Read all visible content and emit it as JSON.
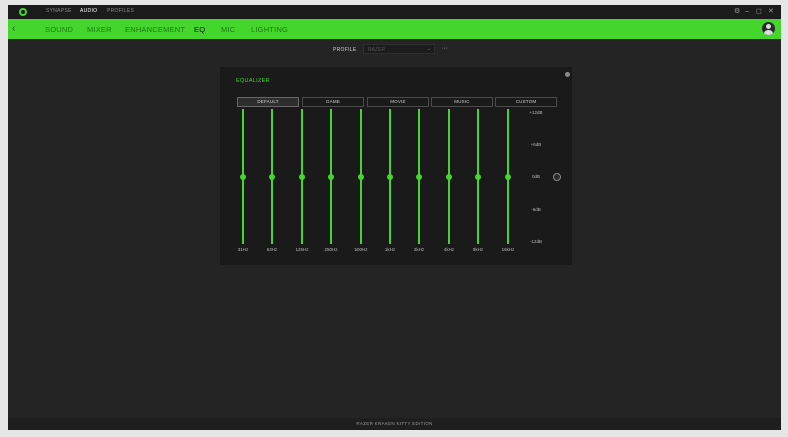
{
  "colors": {
    "accent": "#44d62c",
    "background": "#242424",
    "panel": "#1a1a1a"
  },
  "titlebar": {
    "logo_icon": "razer-snake-icon",
    "tabs": [
      {
        "label": "SYNAPSE"
      },
      {
        "label": "AUDIO",
        "active": true
      },
      {
        "label": "PROFILES"
      }
    ],
    "controls": {
      "settings": "⚙",
      "minimize": "–",
      "maximize": "◻",
      "close": "✕"
    }
  },
  "navbar": {
    "back_glyph": "‹",
    "tabs": [
      {
        "label": "SOUND"
      },
      {
        "label": "MIXER"
      },
      {
        "label": "ENHANCEMENT"
      },
      {
        "label": "EQ",
        "active": true
      },
      {
        "label": "MIC"
      },
      {
        "label": "LIGHTING"
      }
    ],
    "avatar_icon": "user-avatar-icon"
  },
  "profile": {
    "label": "PROFILE",
    "value": "RAZER",
    "chevron": "⌄",
    "more": "···"
  },
  "equalizer": {
    "title": "EQUALIZER",
    "presets": [
      {
        "label": "DEFAULT",
        "active": true
      },
      {
        "label": "GAME"
      },
      {
        "label": "MOVIE"
      },
      {
        "label": "MUSIC"
      },
      {
        "label": "CUSTOM"
      }
    ],
    "bands": [
      {
        "freq": "31Hz",
        "gain_db": 0
      },
      {
        "freq": "63Hz",
        "gain_db": 0
      },
      {
        "freq": "125Hz",
        "gain_db": 0
      },
      {
        "freq": "250Hz",
        "gain_db": 0
      },
      {
        "freq": "500Hz",
        "gain_db": 0
      },
      {
        "freq": "1kHz",
        "gain_db": 0
      },
      {
        "freq": "2kHz",
        "gain_db": 0
      },
      {
        "freq": "4kHz",
        "gain_db": 0
      },
      {
        "freq": "8kHz",
        "gain_db": 0
      },
      {
        "freq": "16kHz",
        "gain_db": 0
      }
    ],
    "db_scale": [
      "+12dB",
      "+6dB",
      "0dB",
      "-6dB",
      "-12dB"
    ],
    "gain_range": [
      -12,
      12
    ]
  },
  "footer": {
    "device": "RAZER KRAKEN KITTY EDITION"
  }
}
